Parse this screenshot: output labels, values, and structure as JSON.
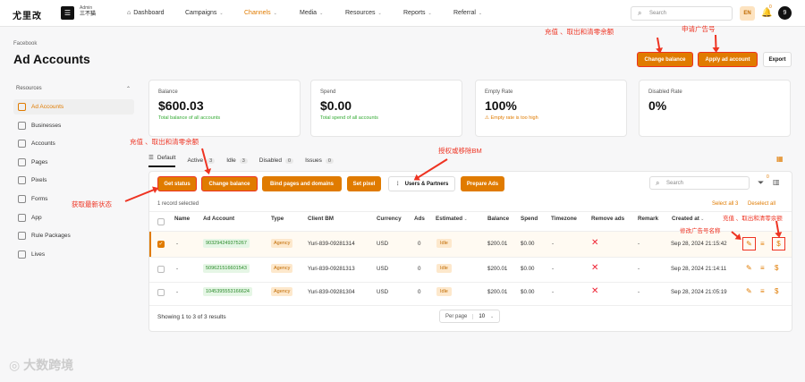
{
  "top": {
    "logo": "尤里改",
    "admin_label": "Admin",
    "admin_name": "三不猫",
    "nav": [
      {
        "label": "Dashboard"
      },
      {
        "label": "Campaigns"
      },
      {
        "label": "Channels"
      },
      {
        "label": "Media"
      },
      {
        "label": "Resources"
      },
      {
        "label": "Reports"
      },
      {
        "label": "Referral"
      }
    ],
    "search_placeholder": "Search",
    "lang": "EN",
    "notif_badge": "0",
    "user_initial": "9"
  },
  "page": {
    "breadcrumb": "Facebook",
    "title": "Ad Accounts",
    "btn_change_balance": "Change balance",
    "btn_apply": "Apply ad account",
    "btn_export": "Export"
  },
  "sidebar": {
    "heading": "Resources",
    "items": [
      "Ad Accounts",
      "Businesses",
      "Accounts",
      "Pages",
      "Pixels",
      "Forms",
      "App",
      "Rule Packages",
      "Lives"
    ]
  },
  "cards": [
    {
      "label": "Balance",
      "value": "$600.03",
      "sub": "Total balance of all accounts"
    },
    {
      "label": "Spend",
      "value": "$0.00",
      "sub": "Total spend of all accounts"
    },
    {
      "label": "Empty Rate",
      "value": "100%",
      "sub": "Empty rate is too high"
    },
    {
      "label": "Disabled Rate",
      "value": "0%",
      "sub": ""
    }
  ],
  "tabs": [
    {
      "label": "Default",
      "count": ""
    },
    {
      "label": "Active",
      "count": "3"
    },
    {
      "label": "Idle",
      "count": "3"
    },
    {
      "label": "Disabled",
      "count": "0"
    },
    {
      "label": "Issues",
      "count": "0"
    }
  ],
  "toolbar": {
    "get_status": "Get status",
    "change_balance": "Change balance",
    "bind": "Bind pages and domains",
    "set_pixel": "Set pixel",
    "users": "Users & Partners",
    "prepare": "Prepare Ads",
    "search_placeholder": "Search",
    "filter_badge": "0"
  },
  "table": {
    "selected_info": "1 record selected",
    "select_all": "Select all 3",
    "deselect_all": "Deselect all",
    "headers": [
      "Name",
      "Ad Account",
      "Type",
      "Client BM",
      "Currency",
      "Ads",
      "Estimated",
      "Balance",
      "Spend",
      "Timezone",
      "Remove ads",
      "Remark",
      "Created at"
    ],
    "rows": [
      {
        "name": "-",
        "account": "903294249375267",
        "type": "Agency",
        "bm": "Yuri-839-09281314",
        "currency": "USD",
        "ads": "0",
        "estimated": "Idle",
        "balance": "$200.01",
        "spend": "$0.00",
        "timezone": "-",
        "remark": "-",
        "created": "Sep 28, 2024 21:15:42"
      },
      {
        "name": "-",
        "account": "509621516601543",
        "type": "Agency",
        "bm": "Yuri-839-09281313",
        "currency": "USD",
        "ads": "0",
        "estimated": "Idle",
        "balance": "$200.01",
        "spend": "$0.00",
        "timezone": "-",
        "remark": "-",
        "created": "Sep 28, 2024 21:14:11"
      },
      {
        "name": "-",
        "account": "1045395553166624",
        "type": "Agency",
        "bm": "Yuri-839-09281304",
        "currency": "USD",
        "ads": "0",
        "estimated": "Idle",
        "balance": "$200.01",
        "spend": "$0.00",
        "timezone": "-",
        "remark": "-",
        "created": "Sep 28, 2024 21:05:19"
      }
    ],
    "footer": "Showing 1 to 3 of 3 results",
    "per_page_label": "Per page",
    "per_page_value": "10"
  },
  "annotations": {
    "top_balance": "充值 、取出和清零余额",
    "top_apply": "申请广告号",
    "tab_balance": "充值 、取出和清零余额",
    "bm": "授权或移除BM",
    "status": "获取最新状态",
    "rename": "修改广告号名称",
    "row_balance": "充值 、取出和清零余额"
  },
  "watermark": "大数跨境",
  "colors": {
    "accent": "#e07b00",
    "annotation": "#e32222"
  }
}
